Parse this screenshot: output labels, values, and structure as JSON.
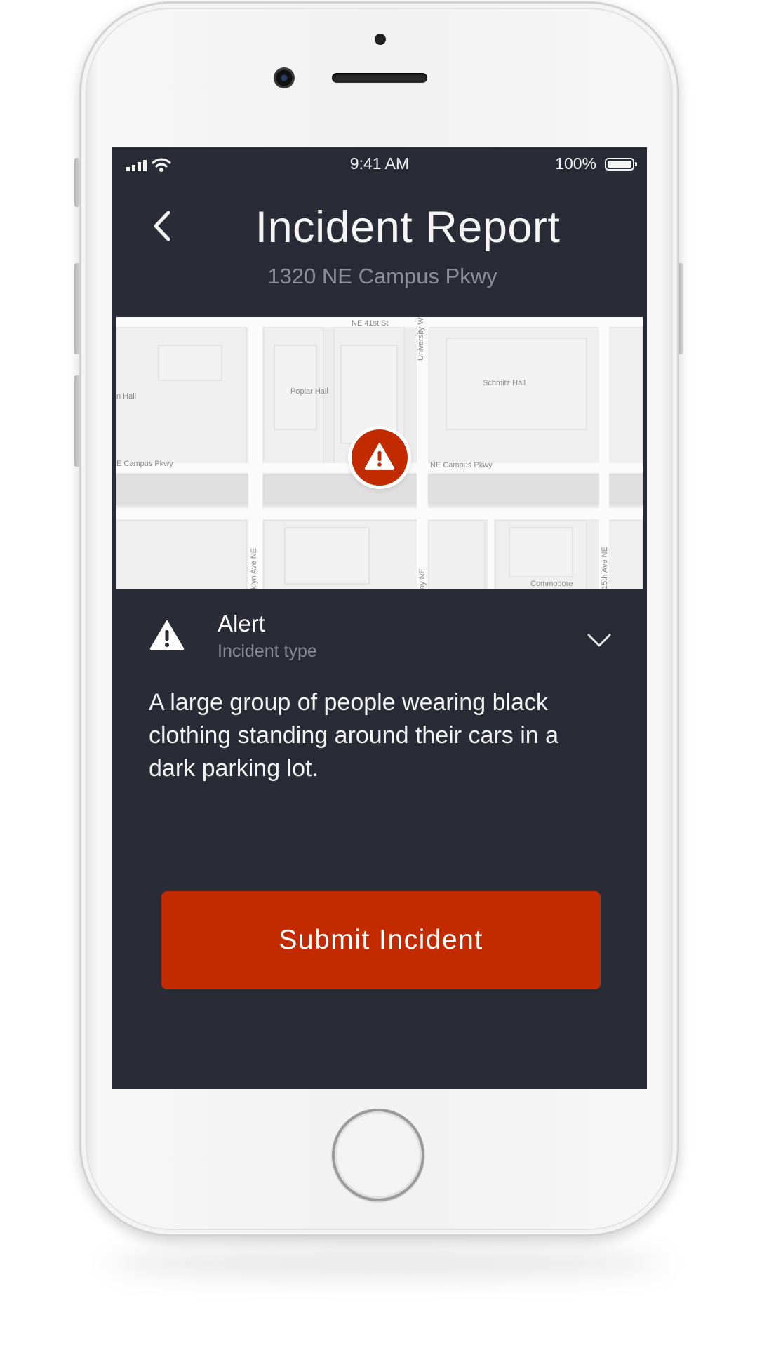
{
  "status_bar": {
    "time": "9:41 AM",
    "battery": "100%"
  },
  "header": {
    "title": "Incident Report",
    "address": "1320 NE Campus Pkwy"
  },
  "map": {
    "labels": {
      "ne_41st_st": "NE 41st St",
      "university_way": "University W",
      "poplar_hall": "Poplar Hall",
      "schmitz_hall": "Schmitz Hall",
      "partial_hall_left": "n Hall",
      "campus_pkwy_left": "E Campus Pkwy",
      "campus_pkwy_right": "NE Campus Pkwy",
      "brooklyn_ave": "klyn Ave NE",
      "street_ne_partial": "ay NE",
      "fifteenth_ave": "15th Ave NE",
      "commodore": "Commodore"
    },
    "pin_icon": "warning-icon",
    "accent_color": "#c22b00"
  },
  "incident_type": {
    "value": "Alert",
    "label": "Incident type",
    "icon": "warning-icon"
  },
  "description": "A large group of people wearing black clothing standing around their cars in a dark parking lot.",
  "submit": {
    "label": "Submit Incident",
    "color": "#c22b00"
  },
  "colors": {
    "background": "#292b37",
    "accent": "#c22b00",
    "muted_text": "#878a96"
  }
}
